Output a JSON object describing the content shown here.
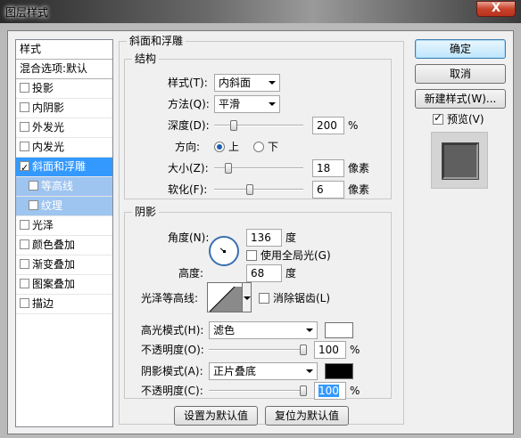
{
  "window": {
    "title": "图层样式",
    "close_label": "X"
  },
  "style_list": {
    "header": "样式",
    "blend": "混合选项:默认",
    "items": [
      {
        "label": "投影",
        "checked": false
      },
      {
        "label": "内阴影",
        "checked": false
      },
      {
        "label": "外发光",
        "checked": false
      },
      {
        "label": "内发光",
        "checked": false
      },
      {
        "label": "斜面和浮雕",
        "checked": true
      },
      {
        "label": "等高线",
        "checked": false
      },
      {
        "label": "纹理",
        "checked": false
      },
      {
        "label": "光泽",
        "checked": false
      },
      {
        "label": "颜色叠加",
        "checked": false
      },
      {
        "label": "渐变叠加",
        "checked": false
      },
      {
        "label": "图案叠加",
        "checked": false
      },
      {
        "label": "描边",
        "checked": false
      }
    ]
  },
  "bevel": {
    "title": "斜面和浮雕",
    "structure": {
      "title": "结构",
      "style_label": "样式(T):",
      "style_value": "内斜面",
      "method_label": "方法(Q):",
      "method_value": "平滑",
      "depth_label": "深度(D):",
      "depth_value": "200",
      "depth_unit": "%",
      "direction_label": "方向:",
      "dir_up": "上",
      "dir_down": "下",
      "size_label": "大小(Z):",
      "size_value": "18",
      "size_unit": "像素",
      "soften_label": "软化(F):",
      "soften_value": "6",
      "soften_unit": "像素"
    },
    "shading": {
      "title": "阴影",
      "angle_label": "角度(N):",
      "angle_value": "136",
      "angle_unit": "度",
      "global_light_label": "使用全局光(G)",
      "altitude_label": "高度:",
      "altitude_value": "68",
      "altitude_unit": "度",
      "gloss_label": "光泽等高线:",
      "antialias_label": "消除锯齿(L)",
      "highlight_label": "高光模式(H):",
      "highlight_value": "滤色",
      "highlight_color": "#ffffff",
      "opacity1_label": "不透明度(O):",
      "opacity1_value": "100",
      "opacity1_unit": "%",
      "shadow_label": "阴影模式(A):",
      "shadow_value": "正片叠底",
      "shadow_color": "#000000",
      "opacity2_label": "不透明度(C):",
      "opacity2_value": "100",
      "opacity2_unit": "%"
    },
    "make_default": "设置为默认值",
    "reset_default": "复位为默认值"
  },
  "buttons": {
    "ok": "确定",
    "cancel": "取消",
    "new_style": "新建样式(W)...",
    "preview": "预览(V)"
  },
  "colors": {
    "selection": "#3399ff",
    "sub_selection": "#9ec4f0",
    "default_button": "#bee6fd"
  }
}
